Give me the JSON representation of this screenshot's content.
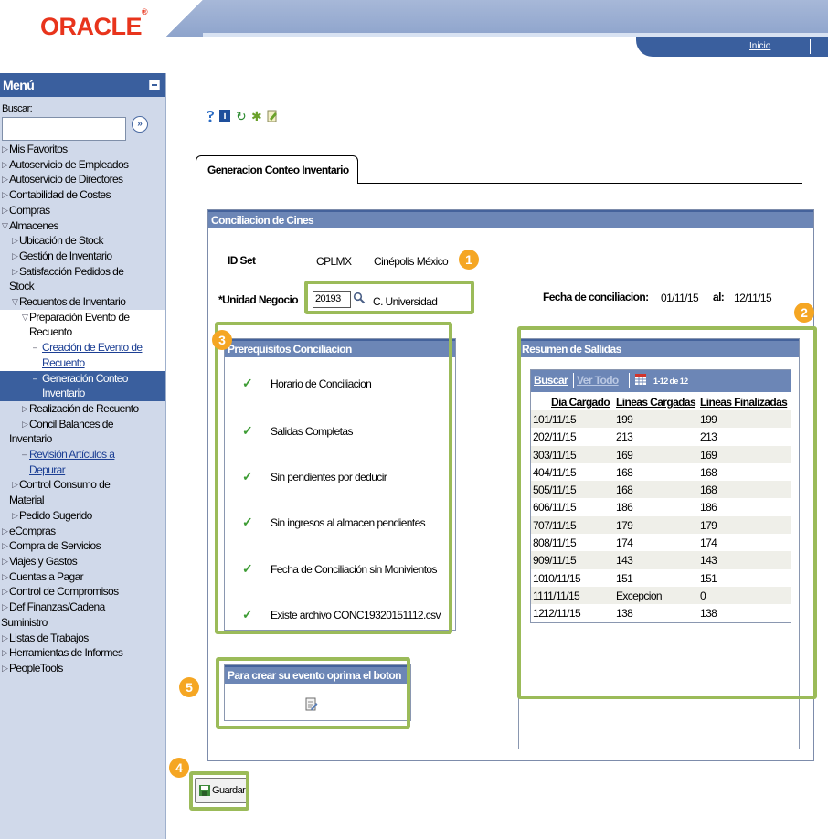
{
  "header": {
    "logo_text": "ORACLE",
    "logo_mark": "®",
    "nav_link": "Inicio"
  },
  "sidebar": {
    "title": "Menú",
    "search_label": "Buscar:",
    "search_go": "»",
    "items": [
      {
        "label": "Mis Favoritos",
        "level": 1,
        "arrow": "▷"
      },
      {
        "label": "Autoservicio de Empleados",
        "level": 1,
        "arrow": "▷"
      },
      {
        "label": "Autoservicio de Directores",
        "level": 1,
        "arrow": "▷"
      },
      {
        "label": "Contabilidad de Costes",
        "level": 1,
        "arrow": "▷"
      },
      {
        "label": "Compras",
        "level": 1,
        "arrow": "▷"
      },
      {
        "label": "Almacenes",
        "level": 1,
        "arrow": "▽"
      },
      {
        "label": "Ubicación de Stock",
        "level": 2,
        "arrow": "▷"
      },
      {
        "label": "Gestión de Inventario",
        "level": 2,
        "arrow": "▷"
      },
      {
        "label": "Satisfacción Pedidos de",
        "level": 2,
        "arrow": "▷"
      },
      {
        "label": "Stock",
        "level": 1,
        "arrow": ""
      },
      {
        "label": "Recuentos de Inventario",
        "level": 2,
        "arrow": "▽"
      },
      {
        "label": "Preparación Evento de",
        "level": 3,
        "arrow": "▽",
        "style": "white"
      },
      {
        "label": "Recuento",
        "level": 3,
        "arrow": "",
        "style": "white"
      },
      {
        "label": "Creación de Evento de",
        "level": 4,
        "arrow": "–",
        "style": "white link"
      },
      {
        "label": "Recuento",
        "level": 4,
        "arrow": "",
        "style": "white link"
      },
      {
        "label": "Generación Conteo",
        "level": 4,
        "arrow": "–",
        "style": "active"
      },
      {
        "label": "Inventario",
        "level": 4,
        "arrow": "",
        "style": "active"
      },
      {
        "label": "Realización de Recuento",
        "level": 3,
        "arrow": "▷"
      },
      {
        "label": "Concil Balances de",
        "level": 3,
        "arrow": "▷"
      },
      {
        "label": "Inventario",
        "level": 1,
        "arrow": ""
      },
      {
        "label": "Revisión Artículos a",
        "level": 3,
        "arrow": "–",
        "style": "link"
      },
      {
        "label": "Depurar",
        "level": 3,
        "arrow": "",
        "style": "link"
      },
      {
        "label": "Control Consumo de",
        "level": 2,
        "arrow": "▷"
      },
      {
        "label": "Material",
        "level": 1,
        "arrow": ""
      },
      {
        "label": "Pedido Sugerido",
        "level": 2,
        "arrow": "▷"
      },
      {
        "label": "eCompras",
        "level": 1,
        "arrow": "▷"
      },
      {
        "label": "Compra de Servicios",
        "level": 1,
        "arrow": "▷"
      },
      {
        "label": "Viajes y Gastos",
        "level": 1,
        "arrow": "▷"
      },
      {
        "label": "Cuentas a Pagar",
        "level": 1,
        "arrow": "▷"
      },
      {
        "label": "Control de Compromisos",
        "level": 1,
        "arrow": "▷"
      },
      {
        "label": "Def Finanzas/Cadena",
        "level": 1,
        "arrow": "▷"
      },
      {
        "label": "Suministro",
        "level": 0,
        "arrow": ""
      },
      {
        "label": "Listas de Trabajos",
        "level": 1,
        "arrow": "▷"
      },
      {
        "label": "Herramientas de Informes",
        "level": 1,
        "arrow": "▷"
      },
      {
        "label": "PeopleTools",
        "level": 1,
        "arrow": "▷"
      }
    ]
  },
  "toolbar": {
    "info_glyph": "i",
    "refresh_glyph": "↻",
    "gear_glyph": "✱"
  },
  "tab": {
    "label": "Generacion Conteo Inventario"
  },
  "main": {
    "title": "Conciliacion de Cines",
    "id_set_label": "ID Set",
    "id_set_value": "CPLMX",
    "id_set_desc": "Cinépolis México",
    "unidad_label": "*Unidad Negocio",
    "unidad_value": "20193",
    "unidad_desc": "C. Universidad",
    "fecha_label": "Fecha de conciliacion:",
    "fecha_from": "01/11/15",
    "al_label": "al:",
    "fecha_to": "12/11/15"
  },
  "prereq": {
    "title": "Prerequisitos Conciliacion",
    "check_glyph": "✓",
    "items": [
      "Horario de Conciliacion",
      "Salidas Completas",
      "Sin pendientes por deducir",
      "Sin ingresos al almacen pendientes",
      "Fecha de Conciliación sin Monivientos",
      "Existe archivo CONC19320151112.csv"
    ]
  },
  "resumen": {
    "title": "Resumen de Sallidas",
    "nav_buscar": "Buscar",
    "nav_vertodo": "Ver Todo",
    "nav_count": "1-12 de 12",
    "columns": [
      "Dia Cargado",
      "Lineas Cargadas",
      "Lineas Finalizadas"
    ],
    "rows": [
      {
        "n": "1",
        "dia": "01/11/15",
        "cargadas": "199",
        "finalizadas": "199"
      },
      {
        "n": "2",
        "dia": "02/11/15",
        "cargadas": "213",
        "finalizadas": "213"
      },
      {
        "n": "3",
        "dia": "03/11/15",
        "cargadas": "169",
        "finalizadas": "169"
      },
      {
        "n": "4",
        "dia": "04/11/15",
        "cargadas": "168",
        "finalizadas": "168"
      },
      {
        "n": "5",
        "dia": "05/11/15",
        "cargadas": "168",
        "finalizadas": "168"
      },
      {
        "n": "6",
        "dia": "06/11/15",
        "cargadas": "186",
        "finalizadas": "186"
      },
      {
        "n": "7",
        "dia": "07/11/15",
        "cargadas": "179",
        "finalizadas": "179"
      },
      {
        "n": "8",
        "dia": "08/11/15",
        "cargadas": "174",
        "finalizadas": "174"
      },
      {
        "n": "9",
        "dia": "09/11/15",
        "cargadas": "143",
        "finalizadas": "143"
      },
      {
        "n": "10",
        "dia": "10/11/15",
        "cargadas": "151",
        "finalizadas": "151"
      },
      {
        "n": "11",
        "dia": "11/11/15",
        "cargadas": "Excepcion",
        "finalizadas": "0"
      },
      {
        "n": "12",
        "dia": "12/11/15",
        "cargadas": "138",
        "finalizadas": "138"
      }
    ]
  },
  "evento": {
    "title": "Para crear su evento oprima el boton"
  },
  "guardar": {
    "label": "Guardar"
  },
  "annotations": {
    "badges": [
      "1",
      "2",
      "3",
      "4",
      "5"
    ],
    "highlight_color": "#9bbb59",
    "badge_color": "#f5a623"
  },
  "colors": {
    "brand": "#e8341c",
    "nav_blue": "#3a5f9e",
    "group_header": "#6c86b6",
    "sidebar_bg": "#d0d9ea",
    "check_green": "#3d9c34"
  }
}
